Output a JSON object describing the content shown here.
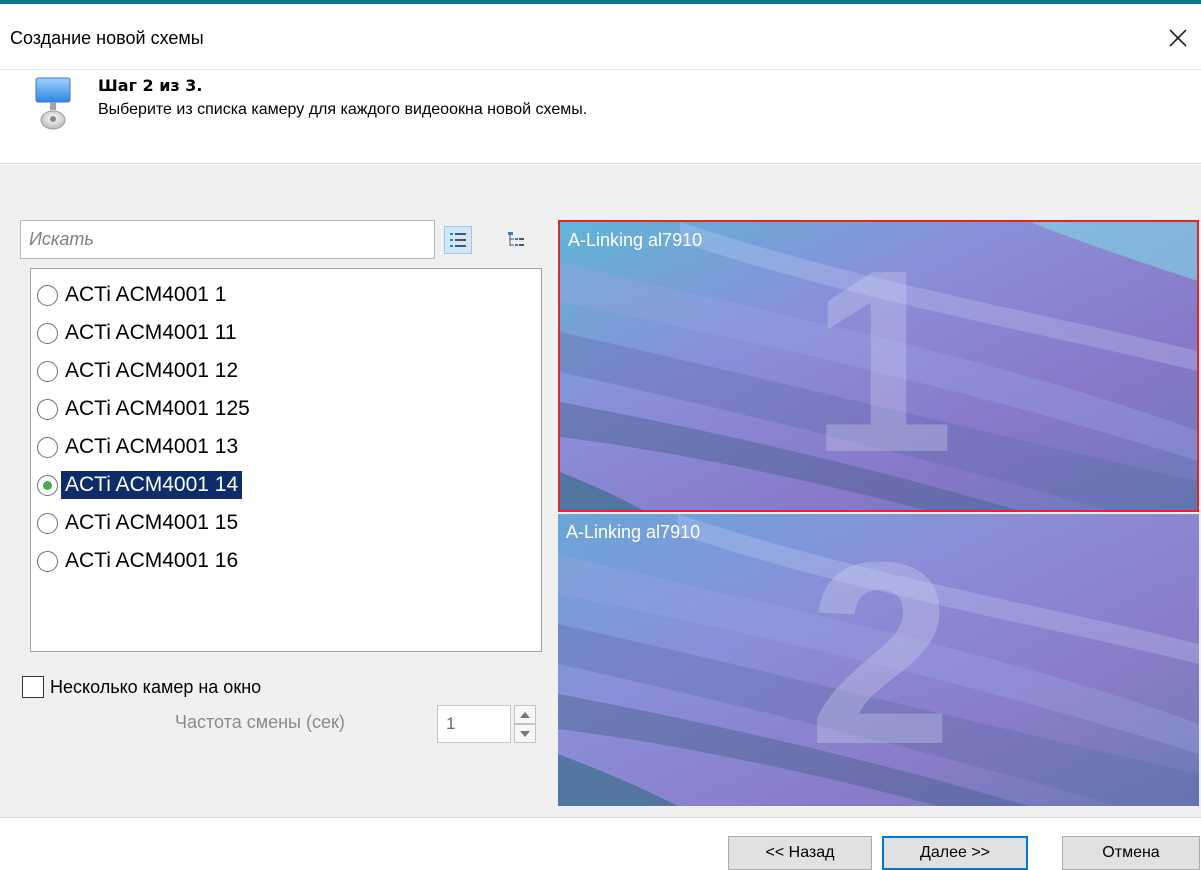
{
  "window": {
    "title": "Создание новой схемы"
  },
  "step": {
    "title": "Шаг 2 из 3.",
    "description": "Выберите из списка камеру для каждого видеоокна новой схемы."
  },
  "search": {
    "placeholder": "Искать"
  },
  "cameras": [
    {
      "label": "ACTi ACM4001 1",
      "selected": false
    },
    {
      "label": "ACTi ACM4001 11",
      "selected": false
    },
    {
      "label": "ACTi ACM4001 12",
      "selected": false
    },
    {
      "label": "ACTi ACM4001 125",
      "selected": false
    },
    {
      "label": "ACTi ACM4001 13",
      "selected": false
    },
    {
      "label": "ACTi ACM4001 14",
      "selected": true
    },
    {
      "label": "ACTi ACM4001 15",
      "selected": false
    },
    {
      "label": "ACTi ACM4001 16",
      "selected": false
    }
  ],
  "options": {
    "multi_camera_label": "Несколько камер на окно",
    "multi_camera_checked": false,
    "frequency_label": "Частота смены (сек)",
    "frequency_value": "1"
  },
  "panes": [
    {
      "camera": "A-Linking al7910",
      "number": "1",
      "active": true
    },
    {
      "camera": "A-Linking al7910",
      "number": "2",
      "active": false
    }
  ],
  "buttons": {
    "back": "<< Назад",
    "next": "Далее >>",
    "cancel": "Отмена"
  },
  "icons": {
    "close": "close-icon",
    "wizard": "monitor-camera-icon",
    "list_view": "list-view-icon",
    "tree_view": "tree-view-icon"
  },
  "colors": {
    "selection": "#0c2c6a",
    "active_pane_border": "#e0262b",
    "default_button_border": "#0078d7",
    "radio_dot": "#4aa84a"
  }
}
